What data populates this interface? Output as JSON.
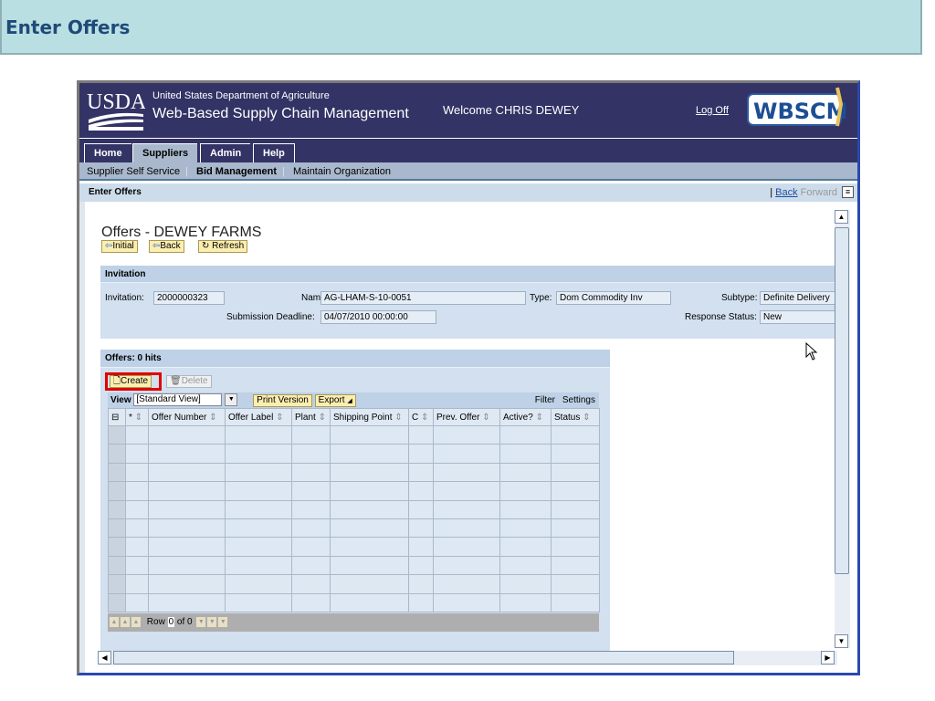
{
  "banner": {
    "title": "Enter Offers"
  },
  "header": {
    "org_line1": "United States Department of Agriculture",
    "org_line2": "Web-Based Supply Chain Management",
    "welcome": "Welcome CHRIS DEWEY",
    "logoff": "Log Off",
    "logo_left": "USDA",
    "logo_right": "WBSCM"
  },
  "tabs": [
    {
      "label": "Home"
    },
    {
      "label": "Suppliers",
      "selected": true
    },
    {
      "label": "Admin"
    },
    {
      "label": "Help"
    }
  ],
  "subnav": [
    {
      "label": "Supplier Self Service"
    },
    {
      "label": "Bid Management",
      "selected": true
    },
    {
      "label": "Maintain Organization"
    }
  ],
  "pagebar": {
    "title": "Enter Offers",
    "back": "Back",
    "forward": "Forward"
  },
  "page": {
    "title": "Offers - DEWEY FARMS",
    "buttons": {
      "initial": "Initial",
      "back": "Back",
      "refresh": "Refresh"
    }
  },
  "invitation": {
    "header": "Invitation",
    "invitation_label": "Invitation:",
    "invitation_value": "2000000323",
    "name_label": "Name:",
    "name_value": "AG-LHAM-S-10-0051",
    "type_label": "Type:",
    "type_value": "Dom Commodity Inv",
    "subtype_label": "Subtype:",
    "subtype_value": "Definite Delivery",
    "deadline_label": "Submission Deadline:",
    "deadline_value": "04/07/2010 00:00:00",
    "status_label": "Response Status:",
    "status_value": "New"
  },
  "offers": {
    "header": "Offers: 0 hits",
    "create": "Create",
    "delete": "Delete",
    "view_label": "View",
    "view_value": "[Standard View]",
    "print": "Print Version",
    "export": "Export",
    "filter": "Filter",
    "settings": "Settings",
    "columns": [
      "*",
      "Offer Number",
      "Offer Label",
      "Plant",
      "Shipping Point",
      "C",
      "Prev. Offer",
      "Active?",
      "Status"
    ],
    "row_label": "Row",
    "row_value": "0",
    "row_of": "of 0"
  },
  "colors": {
    "navy": "#333366",
    "banner": "#b9dfe3",
    "highlight": "#e00000"
  }
}
